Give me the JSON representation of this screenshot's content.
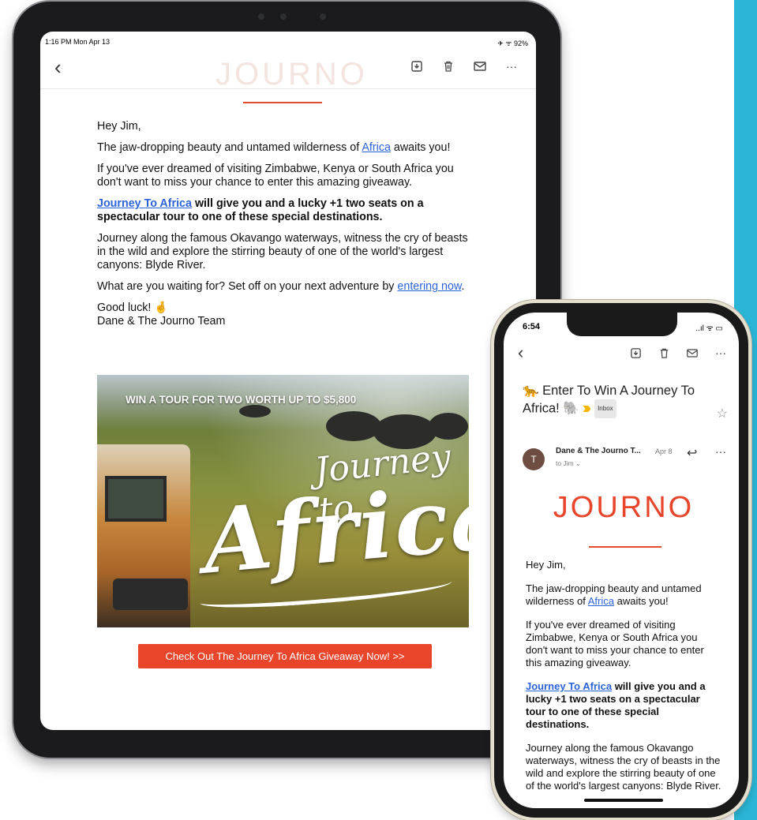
{
  "tablet": {
    "status": {
      "time": "1:16 PM  Mon Apr 13",
      "right": "✈ ᯤ 92%"
    },
    "watermark": "JOURNO",
    "email": {
      "greeting": "Hey Jim,",
      "p1_pre": "The jaw-dropping beauty and untamed wilderness of ",
      "p1_link": "Africa",
      "p1_post": " awaits you!",
      "p2": "If you've ever dreamed of visiting Zimbabwe, Kenya or South Africa you don't want to miss your chance to enter this amazing giveaway.",
      "p3_link": "Journey To Africa",
      "p3_rest": " will give you and a lucky +1 two seats on a spectacular tour to one of these special destinations.",
      "p4": "Journey along the famous Okavango waterways, witness the cry of beasts in the wild and explore the stirring beauty of one of the world's largest canyons: Blyde River.",
      "p5_pre": "What are you waiting for? Set off on your next adventure by ",
      "p5_link": "entering now",
      "p5_post": ".",
      "signoff": "Good luck! 🤞",
      "signature": "Dane & The Journo Team"
    },
    "hero": {
      "headline": "WIN A TOUR FOR TWO WORTH UP TO $5,800",
      "script_small": "Journey to",
      "script_large": "Africa"
    },
    "cta": "Check Out The Journey To Africa Giveaway Now! >>"
  },
  "phone": {
    "status": {
      "time": "6:54",
      "right": "..ıl ᯤ ▭"
    },
    "subject": "🐆 Enter To Win A Journey To Africa! 🐘",
    "label": "Inbox",
    "sender": {
      "avatar": "T",
      "name": "Dane & The Journo T...",
      "date": "Apr 8",
      "to": "to Jim ⌄"
    },
    "logo": "JOURNO",
    "email": {
      "greeting": "Hey Jim,",
      "p1_pre": "The jaw-dropping beauty and untamed wilderness of ",
      "p1_link": "Africa",
      "p1_post": " awaits you!",
      "p2": "If you've ever dreamed of visiting Zimbabwe, Kenya or South Africa you don't want to miss your chance to enter this amazing giveaway.",
      "p3_link": "Journey To Africa",
      "p3_rest": " will give you and a lucky +1 two seats on a spectacular tour to one of these special destinations.",
      "p4": "Journey along the famous Okavango waterways, witness the cry of beasts in the wild and explore the stirring beauty of one of the world's largest canyons: Blyde River."
    }
  },
  "icons": {
    "back": "‹",
    "archive": "archive-icon",
    "trash": "trash-icon",
    "mail": "mail-icon",
    "more": "···",
    "star": "☆",
    "reply": "↩"
  }
}
